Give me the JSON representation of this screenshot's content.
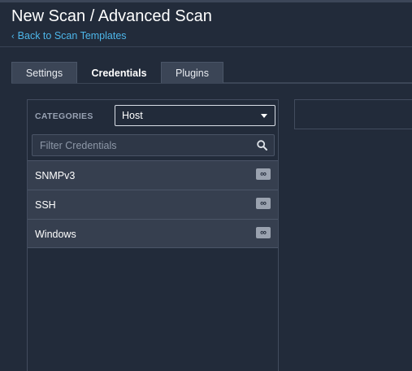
{
  "header": {
    "title": "New Scan / Advanced Scan",
    "back_link": "Back to Scan Templates"
  },
  "tabs": [
    {
      "label": "Settings",
      "active": false
    },
    {
      "label": "Credentials",
      "active": true
    },
    {
      "label": "Plugins",
      "active": false
    }
  ],
  "credentials": {
    "categories_label": "CATEGORIES",
    "category_selected": "Host",
    "filter_placeholder": "Filter Credentials",
    "items": [
      {
        "label": "SNMPv3",
        "badge": "∞"
      },
      {
        "label": "SSH",
        "badge": "∞"
      },
      {
        "label": "Windows",
        "badge": "∞"
      }
    ]
  },
  "icons": {
    "back": "chevron-left-icon",
    "dropdown": "caret-down-icon",
    "search": "search-icon",
    "unlimited": "infinity-icon"
  },
  "colors": {
    "background": "#222b3a",
    "link": "#4db6e9",
    "tab_inactive": "#3b4556",
    "row": "#363f4f"
  }
}
